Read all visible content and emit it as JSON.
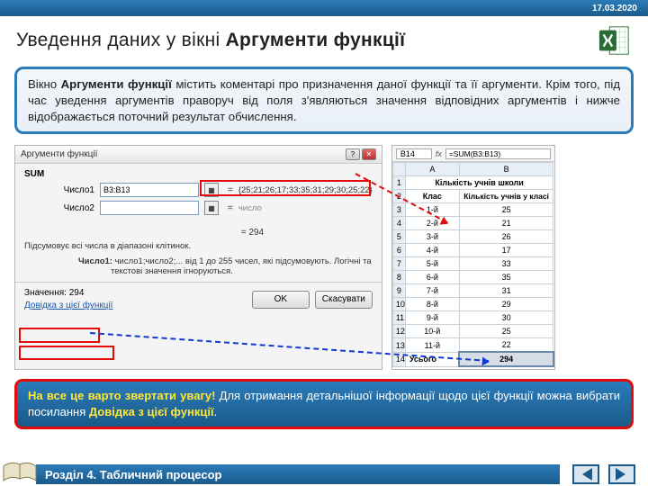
{
  "date": "17.03.2020",
  "title_prefix": "Уведення даних у вікні ",
  "title_bold": "Аргументи функції",
  "info_p1a": "Вікно ",
  "info_p1b": "Аргументи функції",
  "info_p1c": " містить коментарі про призначення даної функції та її аргументи. Крім того, під час уведення аргументів праворуч від поля з'являються значення відповідних аргументів і нижче відображається поточний результат обчислення.",
  "dialog": {
    "title": "Аргументи функції",
    "fn": "SUM",
    "arg1_label": "Число1",
    "arg1_value": "B3:B13",
    "arg1_result": "{25;21;26;17;33;35;31;29;30;25;22}",
    "arg2_label": "Число2",
    "arg2_placeholder": "число",
    "eq": "=",
    "calc": "=  294",
    "desc": "Підсумовує всі числа в діапазоні клітинок.",
    "arg_desc_b": "Число1:",
    "arg_desc": " число1;число2;... від 1 до 255 чисел, які підсумовують. Логічні та текстові значення ігноруються.",
    "value_label": "Значення:  294",
    "help": "Довідка з цієї функції",
    "ok": "OK",
    "cancel": "Скасувати"
  },
  "sheet": {
    "cellref": "B14",
    "fx": "fx",
    "formula": "=SUM(B3:B13)",
    "colA": "A",
    "colB": "B",
    "merged_title": "Кількість учнів школи",
    "hdrA": "Клас",
    "hdrB": "Кількість учнів у класі",
    "rows": [
      {
        "n": "3",
        "a": "1-й",
        "b": "25"
      },
      {
        "n": "4",
        "a": "2-й",
        "b": "21"
      },
      {
        "n": "5",
        "a": "3-й",
        "b": "26"
      },
      {
        "n": "6",
        "a": "4-й",
        "b": "17"
      },
      {
        "n": "7",
        "a": "5-й",
        "b": "33"
      },
      {
        "n": "8",
        "a": "6-й",
        "b": "35"
      },
      {
        "n": "9",
        "a": "7-й",
        "b": "31"
      },
      {
        "n": "10",
        "a": "8-й",
        "b": "29"
      },
      {
        "n": "11",
        "a": "9-й",
        "b": "30"
      },
      {
        "n": "12",
        "a": "10-й",
        "b": "25"
      },
      {
        "n": "13",
        "a": "11-й",
        "b": "22"
      }
    ],
    "total_row": "14",
    "total_a": "Усього",
    "total_b": "294"
  },
  "warn": {
    "em1": "На все це варто звертати увагу!",
    "t1": " Для отримання детальнішої інформації щодо цієї функції можна вибрати посилання ",
    "em2": "Довідка з цієї функції",
    "t2": "."
  },
  "footer": "Розділ 4. Табличний процесор"
}
